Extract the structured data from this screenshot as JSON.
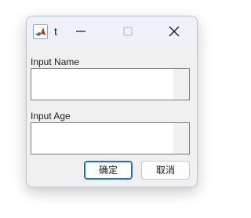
{
  "window": {
    "title": "t",
    "icon": "matlab-icon",
    "controls": {
      "minimize_icon": "minimize-icon",
      "maximize_icon": "maximize-icon",
      "close_icon": "close-icon"
    }
  },
  "form": {
    "name_label": "Input Name",
    "name_value": "",
    "age_label": "Input Age",
    "age_value": ""
  },
  "buttons": {
    "ok_label": "确定",
    "cancel_label": "取消"
  },
  "colors": {
    "titlebar": "#eef2f8",
    "dialog_background": "#f0f0f0",
    "default_button_border": "#1f6fbf"
  }
}
